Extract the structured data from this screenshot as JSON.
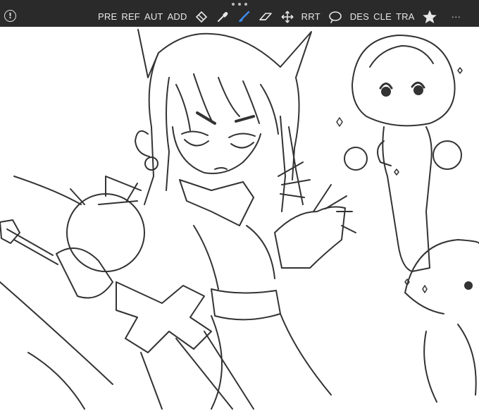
{
  "toolbar": {
    "menu_button_glyph": "!",
    "more_glyph": "···",
    "tools": [
      {
        "type": "text",
        "label": "PRE",
        "name": "tool-pre"
      },
      {
        "type": "text",
        "label": "REF",
        "name": "tool-ref"
      },
      {
        "type": "text",
        "label": "AUT",
        "name": "tool-aut"
      },
      {
        "type": "text",
        "label": "ADD",
        "name": "tool-add"
      },
      {
        "type": "icon",
        "icon": "eraser-tag-icon",
        "name": "tool-fill"
      },
      {
        "type": "icon",
        "icon": "eyedropper-icon",
        "name": "tool-eyedropper"
      },
      {
        "type": "icon",
        "icon": "brush-icon",
        "name": "tool-brush",
        "active": true
      },
      {
        "type": "icon",
        "icon": "eraser-icon",
        "name": "tool-eraser"
      },
      {
        "type": "icon",
        "icon": "move-icon",
        "name": "tool-move"
      },
      {
        "type": "text",
        "label": "RRT",
        "name": "tool-rrt"
      },
      {
        "type": "icon",
        "icon": "speech-bubble-icon",
        "name": "tool-lasso"
      },
      {
        "type": "text",
        "label": "DES",
        "name": "tool-des"
      },
      {
        "type": "text",
        "label": "CLE",
        "name": "tool-cle"
      },
      {
        "type": "text",
        "label": "TRA",
        "name": "tool-tra"
      },
      {
        "type": "icon",
        "icon": "star-icon",
        "name": "tool-star"
      }
    ]
  },
  "colors": {
    "toolbar_bg": "#2a2a2a",
    "toolbar_text": "#e8e8e8",
    "brush_active": "#3d8df5",
    "canvas_bg": "#ffffff",
    "ink": "#333333"
  }
}
